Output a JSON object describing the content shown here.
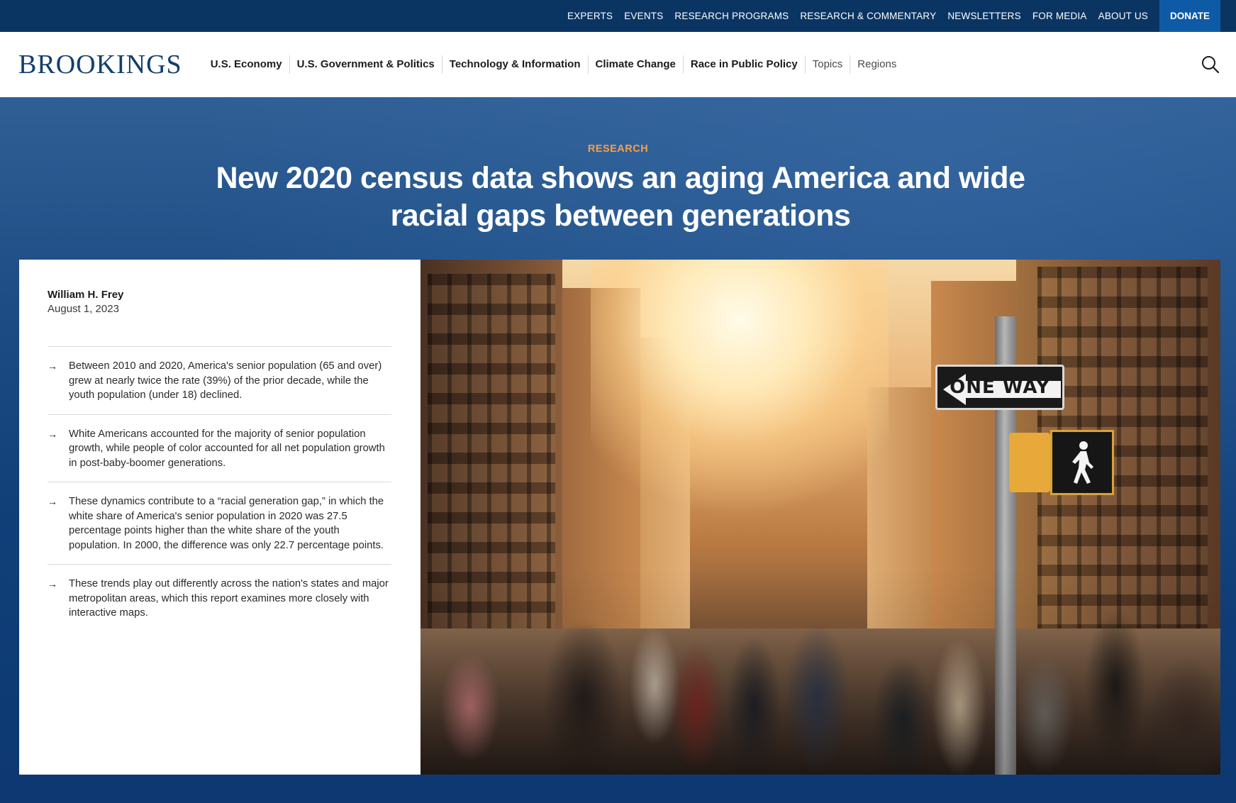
{
  "utility_nav": {
    "links": [
      "EXPERTS",
      "EVENTS",
      "RESEARCH PROGRAMS",
      "RESEARCH & COMMENTARY",
      "NEWSLETTERS",
      "FOR MEDIA",
      "ABOUT US"
    ],
    "donate_label": "DONATE"
  },
  "brand": {
    "logo_text": "BROOKINGS"
  },
  "main_nav": {
    "items": [
      "U.S. Economy",
      "U.S. Government & Politics",
      "Technology & Information",
      "Climate Change",
      "Race in Public Policy",
      "Topics",
      "Regions"
    ]
  },
  "icons": {
    "search": "search-icon",
    "arrow": "arrow-right-icon",
    "walk": "pedestrian-walk-icon"
  },
  "article": {
    "kicker": "RESEARCH",
    "headline": "New 2020 census data shows an aging America and wide racial gaps between generations",
    "author": "William H. Frey",
    "date": "August 1, 2023",
    "takeaways": [
      "Between 2010 and 2020, America's senior population (65 and over) grew at nearly twice the rate (39%) of the prior decade, while the youth population (under 18) declined.",
      "White Americans accounted for the majority of senior population growth, while people of color accounted for all net population growth in post-baby-boomer generations.",
      "These dynamics contribute to a “racial generation gap,” in which the white share of America's senior population in 2020 was 27.5 percentage points higher than the white share of the youth population. In 2000, the difference was only 22.7 percentage points.",
      "These trends play out differently across the nation's states and major metropolitan areas, which this report examines more closely with interactive maps."
    ]
  },
  "hero_image": {
    "sign_text": "ONE WAY"
  },
  "colors": {
    "utility_bar": "#0a3563",
    "donate": "#0f5aa6",
    "kicker": "#f5a04a",
    "logo": "#123e6e",
    "hero_bg": "#1d4c84"
  }
}
